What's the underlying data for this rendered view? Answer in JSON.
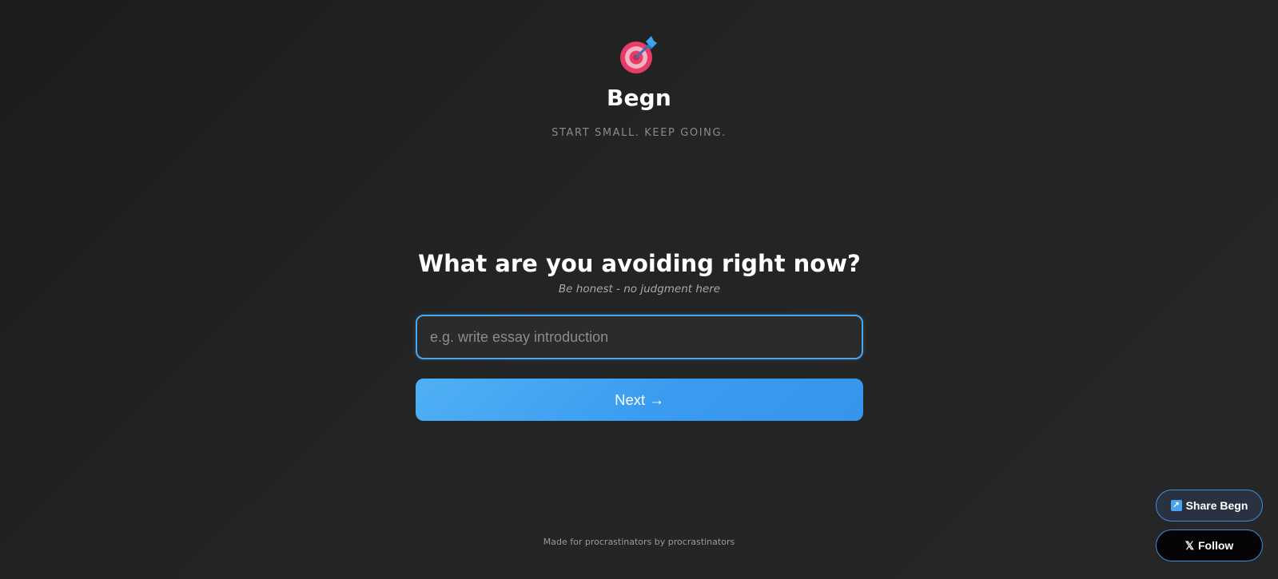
{
  "app": {
    "title": "Begn",
    "tagline": "START SMALL. KEEP GOING.",
    "logo_icon": "dartboard-target-icon"
  },
  "main": {
    "question": "What are you avoiding right now?",
    "hint": "Be honest - no judgment here",
    "input": {
      "value": "",
      "placeholder": "e.g. write essay introduction"
    },
    "next_label": "Next →"
  },
  "footer": {
    "text": "Made for procrastinators by procrastinators"
  },
  "floating": {
    "share_label": "Share Begn",
    "share_icon": "share-arrow-icon",
    "follow_label": "Follow",
    "follow_icon": "x-logo-icon"
  },
  "colors": {
    "accent": "#4aa6ee",
    "background": "#232323",
    "target_red": "#e83d66"
  }
}
